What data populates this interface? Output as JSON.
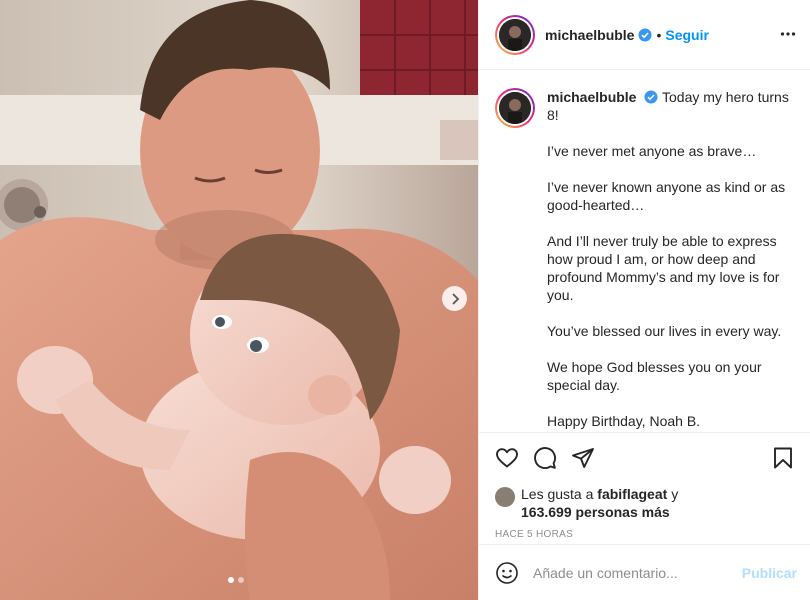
{
  "post": {
    "username": "michaelbuble",
    "follow_label": "Seguir",
    "caption_intro": "Today my hero turns 8!",
    "caption_paragraphs": [
      "I’ve never met anyone as brave…",
      "I’ve never known anyone as kind or as good-hearted…",
      "And I’ll never truly be able to express how proud I am, or how deep and profound Mommy’s and my love is for you.",
      "You’ve blessed our lives in every way.",
      "We hope God blesses you on your special day.",
      "Happy Birthday, Noah B."
    ],
    "likes_prefix": "Les gusta a",
    "likes_user": "fabiflageat",
    "likes_and": "y",
    "likes_count": "163.699 personas más",
    "timestamp": "HACE 5 HORAS",
    "comment_placeholder": "Añade un comentario...",
    "publish_label": "Publicar"
  },
  "carousel": {
    "current": 1,
    "total": 2
  },
  "icons": {
    "verified": "verified-badge-icon",
    "more": "more-options-icon",
    "like": "heart-icon",
    "comment": "comment-icon",
    "share": "share-icon",
    "save": "bookmark-icon",
    "emoji": "emoji-icon",
    "next": "chevron-right-icon"
  },
  "colors": {
    "link": "#0095f6",
    "publish_disabled": "#b2dffc",
    "verified": "#3897f0",
    "muted": "#8e8e8e"
  }
}
